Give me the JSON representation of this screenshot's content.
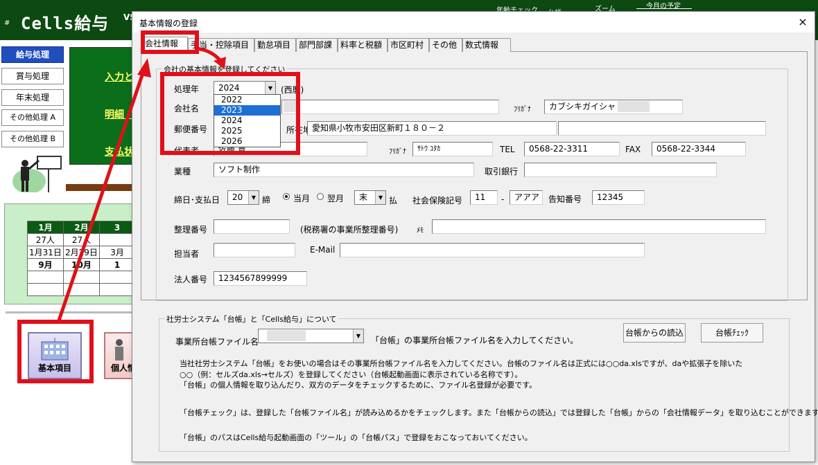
{
  "app": {
    "title": "Cells給与",
    "hash": "#",
    "vs": "VS",
    "header_menu": [
      "年齢チェック",
      "台帳",
      "ズーム",
      "今月の予定"
    ],
    "left_menu": [
      "給与処理",
      "賞与処理",
      "年末処理",
      "その他処理 A",
      "その他処理 B"
    ],
    "panel_links": [
      "入力と",
      "明細・集",
      "支払状"
    ],
    "calendar": {
      "header": [
        "1月",
        "2月",
        "3"
      ],
      "rows": [
        [
          "27人",
          "27人",
          ""
        ],
        [
          "1月31日",
          "2月29日",
          "3月"
        ],
        [
          "9月",
          "10月",
          "1"
        ],
        [
          "",
          "",
          ""
        ],
        [
          "",
          "",
          ""
        ]
      ]
    },
    "kihon_label": "基本項目",
    "kojin_label": "個人情報"
  },
  "dialog": {
    "title": "基本情報の登録",
    "close": "×",
    "tabs": [
      "会社情報",
      "手当・控除項目",
      "勤怠項目",
      "部門部課",
      "料率と税額",
      "市区町村",
      "その他",
      "数式情報"
    ],
    "company_frame_title": "会社の基本情報を登録してください",
    "labels": {
      "year": "処理年",
      "era": "(西暦)",
      "company": "会社名",
      "furigana": "ﾌﾘｶﾞﾅ",
      "postal": "郵便番号",
      "address_prefix": "所在地",
      "rep": "代表者",
      "tel": "TEL",
      "fax": "FAX",
      "industry": "業種",
      "bank": "取引銀行",
      "closing": "締日･支払日",
      "shime": "締",
      "tougetsu": "当月",
      "yokugetsu": "翌月",
      "pay": "払",
      "insurance": "社会保険記号",
      "dash": "-",
      "notice": "告知番号",
      "seiri": "整理番号",
      "seiri_note": "(税務署の事業所整理番号)",
      "memo": "ﾒﾓ",
      "tanto": "担当者",
      "email": "E-Mail",
      "houjin": "法人番号"
    },
    "values": {
      "year": "2024",
      "company_furigana": "カブシキガイシャ",
      "address": "愛知県小牧市安田区新町１８０－２",
      "rep_name": "佐藤 豊",
      "rep_furigana": "ｻﾄｳ ﾕﾀｶ",
      "tel": "0568-22-3311",
      "fax": "0568-22-3344",
      "industry": "ソフト制作",
      "closing_day": "20",
      "pay_day": "末",
      "insurance_1": "11",
      "insurance_2": "アアア",
      "notice_no": "12345",
      "houjin_no": "1234567899999"
    },
    "year_options": [
      "2022",
      "2023",
      "2024",
      "2025",
      "2026"
    ],
    "year_selected_index": 1,
    "daicho_frame_title": "社労士システム「台帳」と「Cells給与」について",
    "daicho_label": "事業所台帳ファイル名",
    "daicho_hint": "「台帳」の事業所台帳ファイル名を入力してください。",
    "btn_read": "台帳からの読込",
    "btn_check": "台帳ﾁｪｯｸ",
    "notes": [
      "当社社労士システム「台帳」をお使いの場合はその事業所台帳ファイル名を入力してください。台帳のファイル名は正式には○○da.xlsですが、daや拡張子を除いた",
      "○○（例：セルズda.xls→セルズ）を登録してください（台帳起動画面に表示されている名称です）。",
      "「台帳」の個人情報を取り込んだり、双方のデータをチェックするために、ファイル名登録が必要です。",
      "「台帳チェック」は、登録した「台帳ファイル名」が読み込めるかをチェックします。また「台帳からの読込」では登録した「台帳」からの「会社情報データ」を取り込むことができます。",
      "「台帳」のパスはCells給与起動画面の「ツール」の「台帳パス」で登録をおこなっておいてください。"
    ]
  },
  "colors": {
    "annotation_red": "#e0101a",
    "header_green": "#0c4a12",
    "selection_blue": "#1e6fd4"
  }
}
